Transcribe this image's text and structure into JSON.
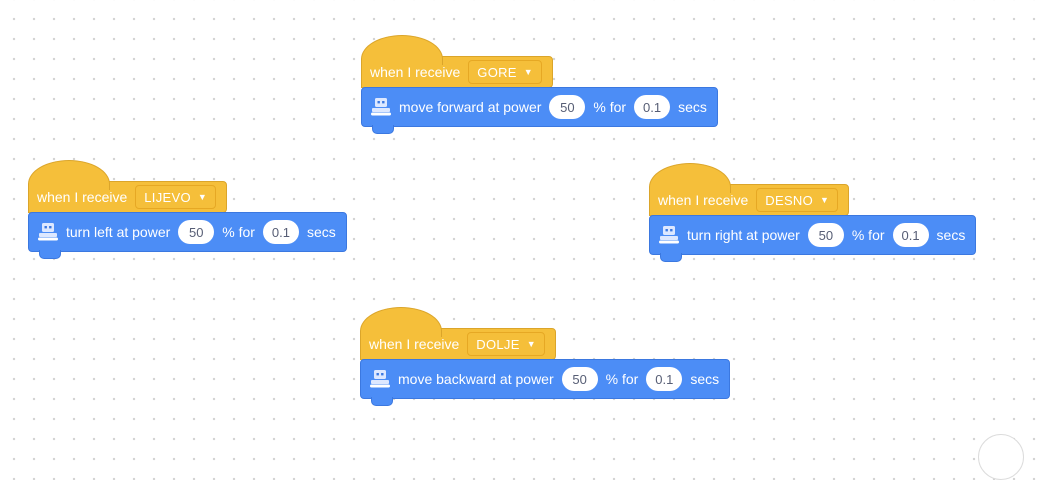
{
  "colors": {
    "event_block": "#f5bf3a",
    "motion_block": "#4c8df6",
    "block_text": "#ffffff",
    "oval_text": "#575e75"
  },
  "scripts": [
    {
      "hat": {
        "label": "when I receive",
        "message": "GORE"
      },
      "block": {
        "icon": "robot-drivetrain-icon",
        "prefix": "move forward at power",
        "power": "50",
        "middle": "% for",
        "time": "0.1",
        "suffix": "secs"
      }
    },
    {
      "hat": {
        "label": "when I receive",
        "message": "LIJEVO"
      },
      "block": {
        "icon": "robot-drivetrain-icon",
        "prefix": "turn left at power",
        "power": "50",
        "middle": "% for",
        "time": "0.1",
        "suffix": "secs"
      }
    },
    {
      "hat": {
        "label": "when I receive",
        "message": "DESNO"
      },
      "block": {
        "icon": "robot-drivetrain-icon",
        "prefix": "turn right at power",
        "power": "50",
        "middle": "% for",
        "time": "0.1",
        "suffix": "secs"
      }
    },
    {
      "hat": {
        "label": "when I receive",
        "message": "DOLJE"
      },
      "block": {
        "icon": "robot-drivetrain-icon",
        "prefix": "move backward at power",
        "power": "50",
        "middle": "% for",
        "time": "0.1",
        "suffix": "secs"
      }
    }
  ]
}
